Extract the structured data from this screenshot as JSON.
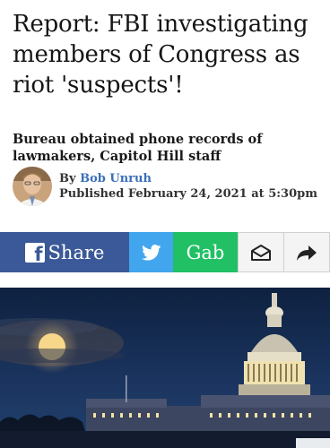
{
  "article": {
    "headline": "Report: FBI investigating members of Congress as riot 'suspects'!",
    "subheadline": "Bureau obtained phone records of lawmakers, Capitol Hill staff",
    "byline_prefix": "By",
    "author": "Bob Unruh",
    "published": "Published February 24, 2021 at 5:30pm"
  },
  "share": {
    "facebook_label": "Share",
    "gab_label": "Gab",
    "icons": [
      "facebook-icon",
      "twitter-icon",
      "email-icon",
      "forward-arrow-icon"
    ],
    "colors": {
      "facebook": "#3b5998",
      "twitter": "#42a6ee",
      "gab": "#21c064"
    }
  },
  "hero_image": {
    "subject": "capitol-dome-full-moon-photo"
  }
}
